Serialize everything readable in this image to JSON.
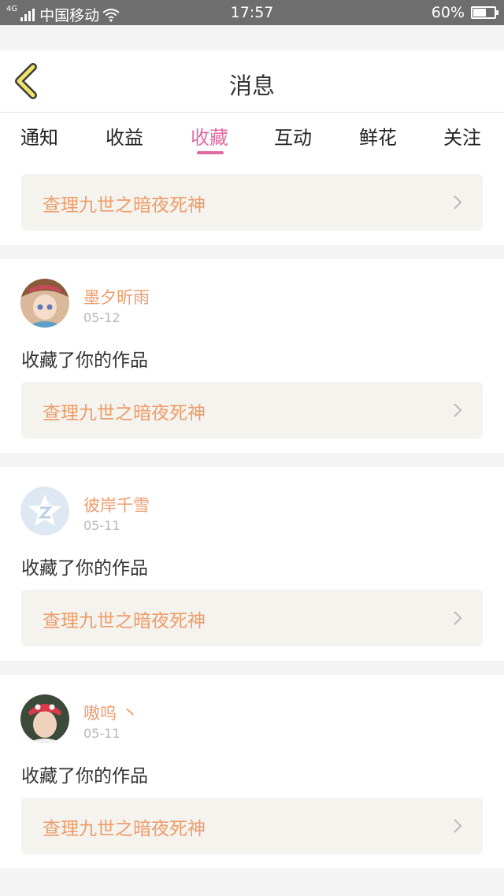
{
  "status_bar": {
    "network": "4G",
    "carrier": "中国移动",
    "time": "17:57",
    "battery": "60%",
    "battery_level": 0.6
  },
  "header": {
    "title": "消息"
  },
  "tabs": [
    {
      "label": "通知",
      "active": false
    },
    {
      "label": "收益",
      "active": false
    },
    {
      "label": "收藏",
      "active": true
    },
    {
      "label": "互动",
      "active": false
    },
    {
      "label": "鲜花",
      "active": false
    },
    {
      "label": "关注",
      "active": false
    }
  ],
  "top_card": {
    "work_title": "查理九世之暗夜死神"
  },
  "messages": [
    {
      "username": "墨夕昕雨",
      "date": "05-12",
      "action": "收藏了你的作品",
      "work_title": "查理九世之暗夜死神"
    },
    {
      "username": "彼岸千雪",
      "date": "05-11",
      "action": "收藏了你的作品",
      "work_title": "查理九世之暗夜死神"
    },
    {
      "username": "嗷呜 丶",
      "date": "05-11",
      "action": "收藏了你的作品",
      "work_title": "查理九世之暗夜死神"
    }
  ],
  "colors": {
    "accent": "#e06aa0",
    "link": "#ee9c6a",
    "back_icon": "#f0e26a"
  },
  "icons": {
    "back": "chevron-left-icon",
    "chevron": "chevron-right-icon",
    "wifi": "wifi-icon",
    "signal": "signal-icon",
    "battery": "battery-icon"
  }
}
